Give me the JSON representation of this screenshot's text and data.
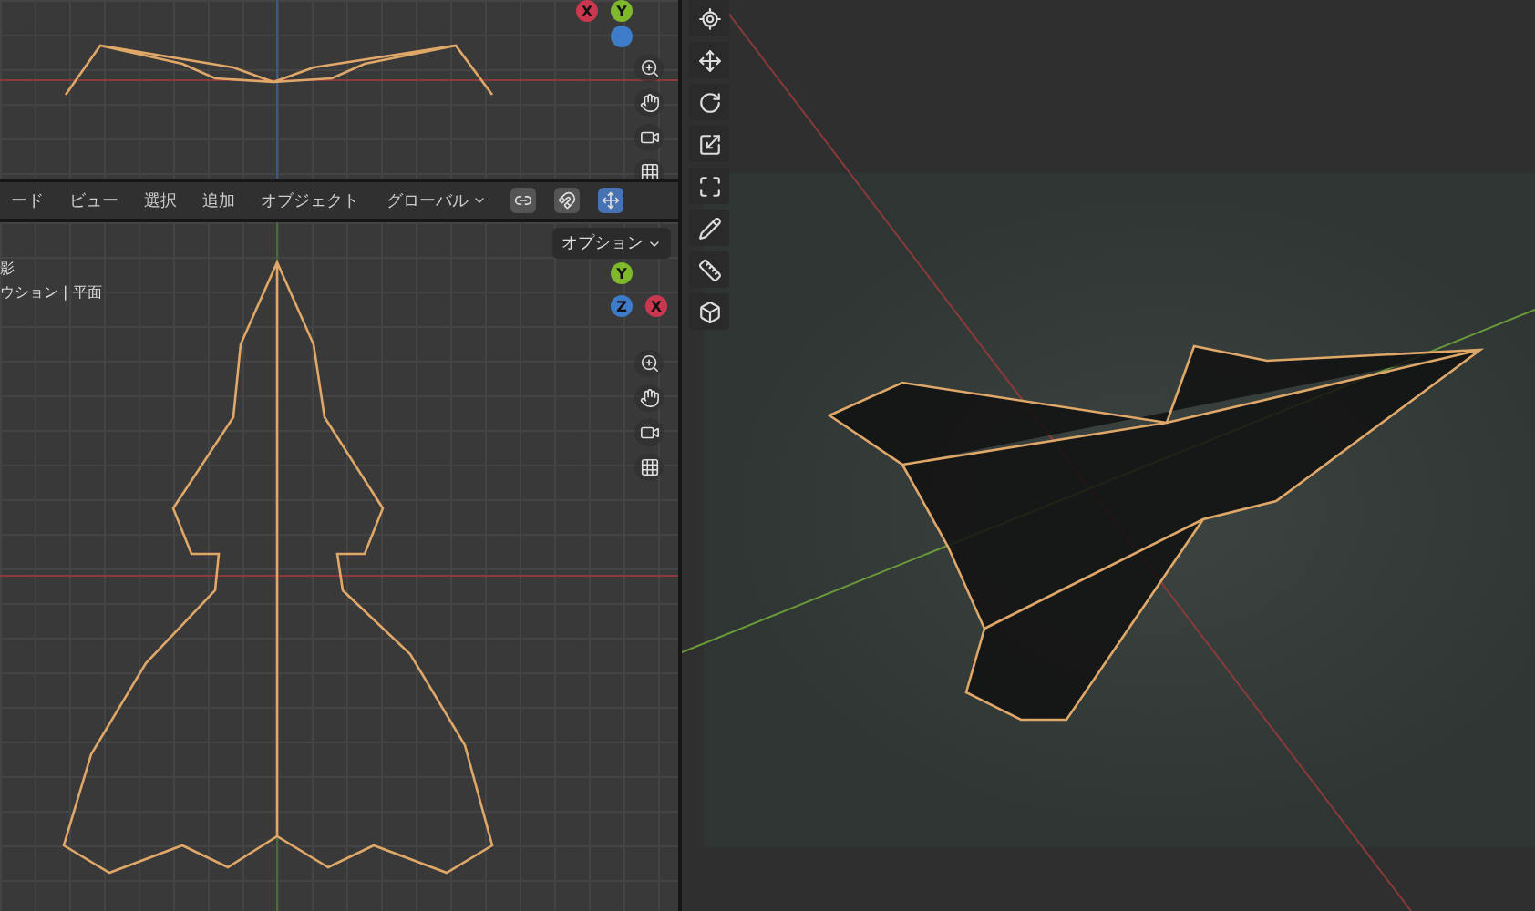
{
  "top_view": {
    "gizmo": [
      {
        "label": "X",
        "color": "#c9384f"
      },
      {
        "label": "Y",
        "color": "#7fb82a"
      },
      {
        "color": "#3e7cc9"
      }
    ]
  },
  "header": {
    "menus": [
      "ード",
      "ビュー",
      "選択",
      "追加",
      "オブジェクト"
    ],
    "orientation": "グローバル",
    "options": "オプション"
  },
  "front_view": {
    "overlay_lines": [
      "影",
      "ウション | 平面"
    ],
    "gizmo": [
      {
        "label": "Y",
        "color": "#7fb82a"
      },
      {
        "label": "Z",
        "color": "#3e7cc9"
      },
      {
        "label": "X",
        "color": "#c9384f"
      }
    ]
  }
}
